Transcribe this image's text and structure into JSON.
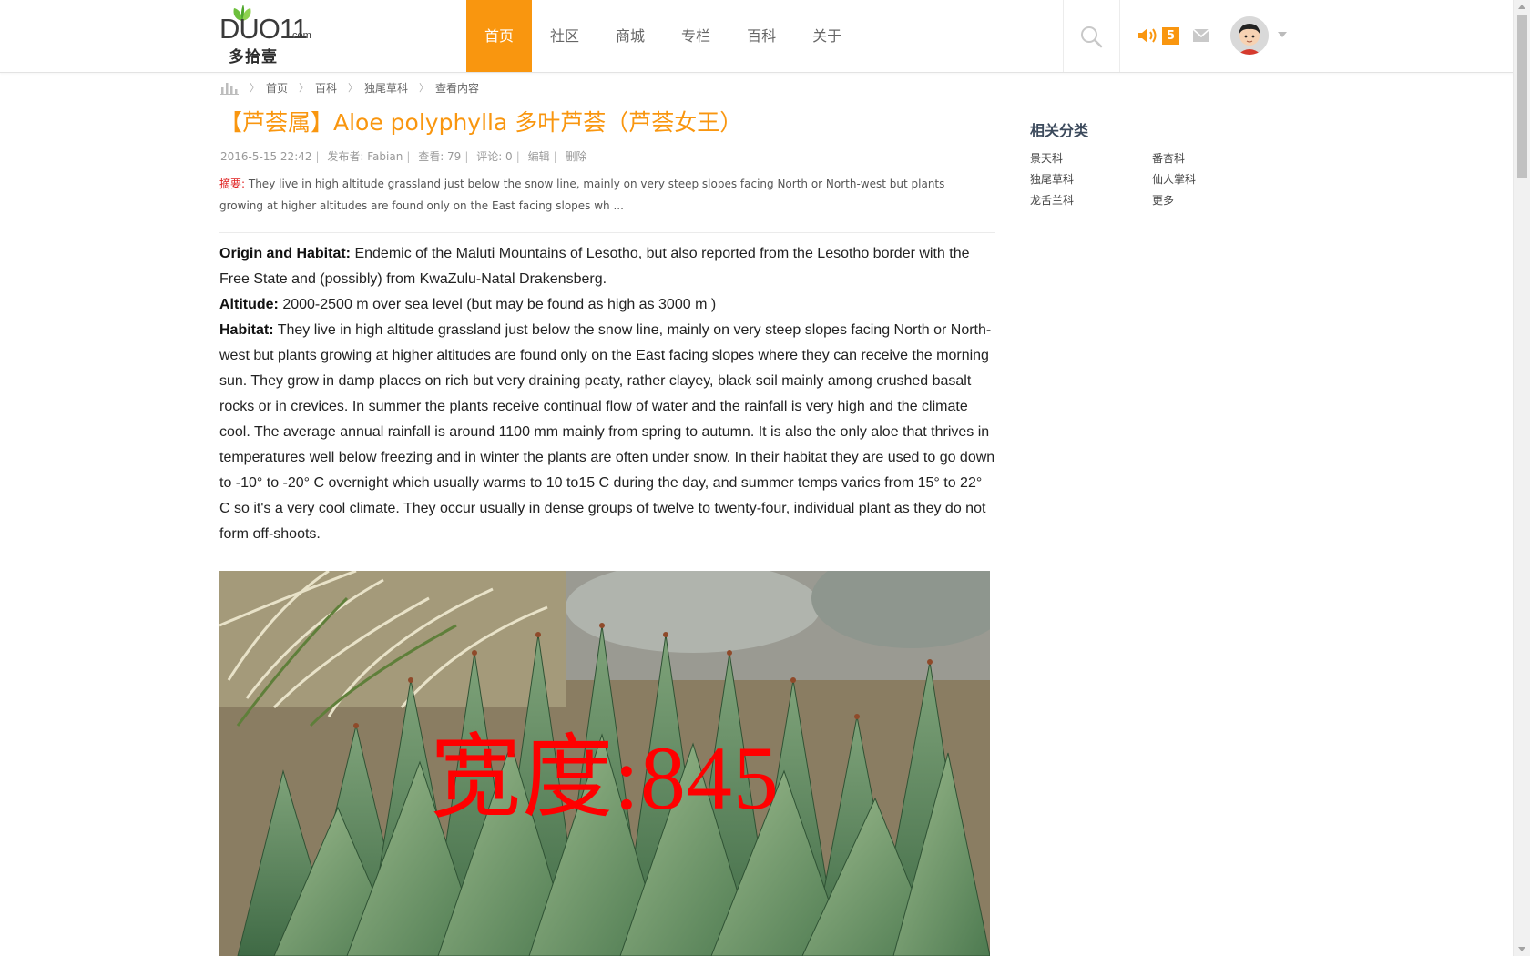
{
  "site": {
    "logo_text": "DUO11",
    "logo_domain": ".com",
    "logo_cn": "多拾壹"
  },
  "nav": {
    "items": [
      {
        "label": "首页",
        "active": true
      },
      {
        "label": "社区",
        "active": false
      },
      {
        "label": "商城",
        "active": false
      },
      {
        "label": "专栏",
        "active": false
      },
      {
        "label": "百科",
        "active": false
      },
      {
        "label": "关于",
        "active": false
      }
    ]
  },
  "header": {
    "notification_count": "5"
  },
  "breadcrumb": [
    "首页",
    "百科",
    "独尾草科",
    "查看内容"
  ],
  "article": {
    "title": "【芦荟属】Aloe polyphylla 多叶芦荟（芦荟女王）",
    "date": "2016-5-15 22:42",
    "author": "发布者: Fabian",
    "views": "查看: 79",
    "comments": "评论: 0",
    "edit": "编辑",
    "delete": "删除",
    "summary_label": "摘要:",
    "summary": "They live in high altitude grassland just below the snow line, mainly on very steep slopes facing North or North-west but plants growing at higher altitudes are found only on the East facing slopes wh ...",
    "origin_label": "Origin and Habitat:",
    "origin_text": "Endemic of the Maluti Mountains of Lesotho, but also reported from the Lesotho border with the Free State and (possibly) from KwaZulu-Natal Drakensberg.",
    "altitude_label": "Altitude:",
    "altitude_text": "2000-2500 m over sea level (but may be found as high as 3000 m )",
    "habitat_label": "Habitat:",
    "habitat_text": "They live in high altitude grassland just below the snow line, mainly on very steep slopes facing North or North-west but plants growing at higher altitudes are found only on the East facing slopes where they can receive the morning sun. They grow in damp places on rich but very draining peaty, rather clayey, black soil mainly among crushed basalt rocks or in crevices. In summer the plants receive continual flow of water and the rainfall is very high and the climate cool. The average annual rainfall is around 1100 mm mainly from spring to autumn. It is also the only aloe that thrives in temperatures well below freezing and in winter the plants are often under snow. In their habitat they are used to go down to -10° to -20° C overnight which usually warms to 10 to15 C during the day, and summer temps varies from 15° to 22° C so it's a very cool climate. They occur usually in dense groups of twelve to twenty-four, individual plant as they do not form off-shoots.",
    "image_watermark": "宽度:845"
  },
  "sidebar": {
    "title": "相关分类",
    "categories": [
      "景天科",
      "番杏科",
      "独尾草科",
      "仙人掌科",
      "龙舌兰科",
      "更多"
    ]
  },
  "colors": {
    "accent": "#f9960f",
    "summary_label": "#e02020",
    "sidebar_title": "#3c4a5c"
  }
}
